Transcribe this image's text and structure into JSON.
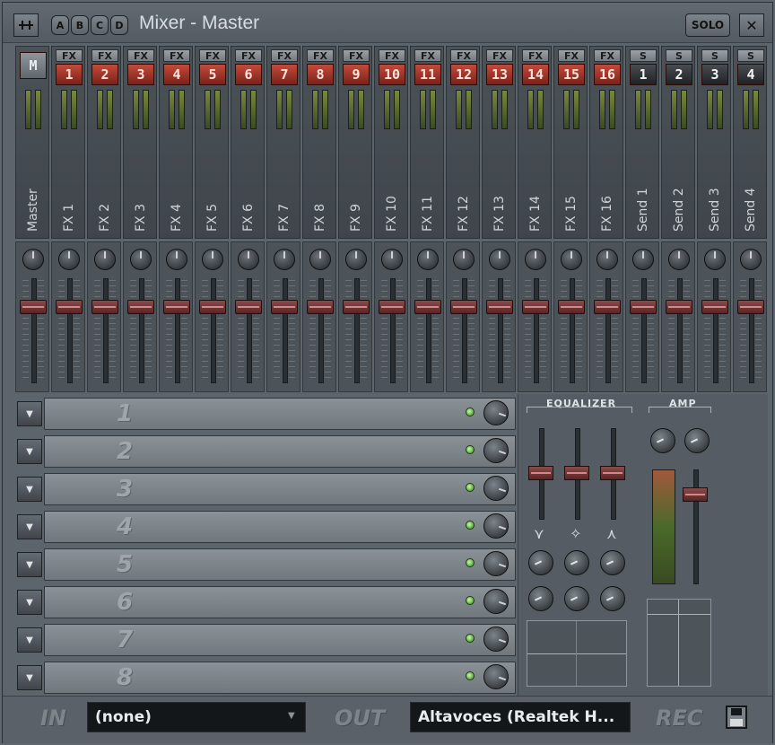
{
  "titlebar": {
    "title": "Mixer - Master",
    "banks": [
      "A",
      "B",
      "C",
      "D"
    ],
    "solo_label": "SOLO",
    "close_label": "✕",
    "menu_icon": "mixer-menu-icon"
  },
  "master": {
    "tag": "M",
    "label": "Master"
  },
  "fx_tag": "FX",
  "send_tag": "S",
  "channels": [
    {
      "num": "1",
      "label": "FX 1"
    },
    {
      "num": "2",
      "label": "FX 2"
    },
    {
      "num": "3",
      "label": "FX 3"
    },
    {
      "num": "4",
      "label": "FX 4"
    },
    {
      "num": "5",
      "label": "FX 5"
    },
    {
      "num": "6",
      "label": "FX 6"
    },
    {
      "num": "7",
      "label": "FX 7"
    },
    {
      "num": "8",
      "label": "FX 8"
    },
    {
      "num": "9",
      "label": "FX 9"
    },
    {
      "num": "10",
      "label": "FX 10"
    },
    {
      "num": "11",
      "label": "FX 11"
    },
    {
      "num": "12",
      "label": "FX 12"
    },
    {
      "num": "13",
      "label": "FX 13"
    },
    {
      "num": "14",
      "label": "FX 14"
    },
    {
      "num": "15",
      "label": "FX 15"
    },
    {
      "num": "16",
      "label": "FX 16"
    }
  ],
  "sends": [
    {
      "num": "1",
      "label": "Send 1"
    },
    {
      "num": "2",
      "label": "Send 2"
    },
    {
      "num": "3",
      "label": "Send 3"
    },
    {
      "num": "4",
      "label": "Send 4"
    }
  ],
  "slots": [
    "1",
    "2",
    "3",
    "4",
    "5",
    "6",
    "7",
    "8"
  ],
  "equalizer": {
    "title": "EQUALIZER",
    "band_symbols": [
      "⋎",
      "✧",
      "⋏"
    ]
  },
  "amp": {
    "title": "AMP"
  },
  "io": {
    "in_label": "IN",
    "in_value": "(none)",
    "out_label": "OUT",
    "out_value": "Altavoces (Realtek H...",
    "rec_label": "REC"
  },
  "colors": {
    "accent_red": "#b23b2c",
    "led_green": "#5fd040",
    "background": "#5d656c"
  }
}
